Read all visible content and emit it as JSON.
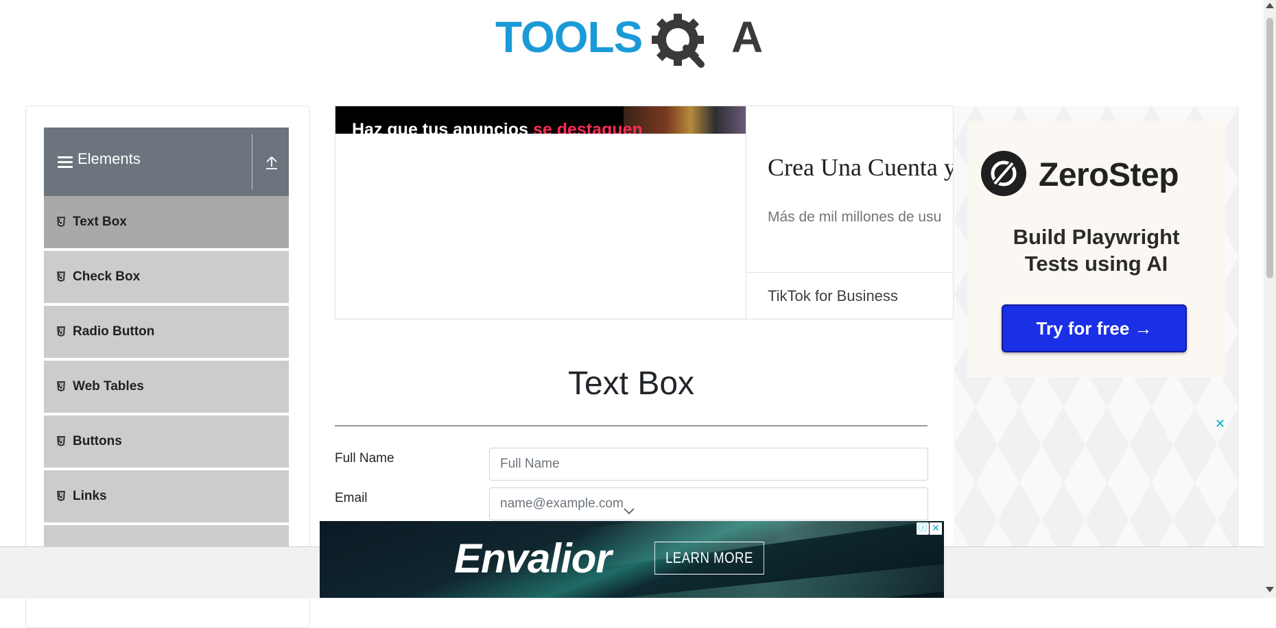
{
  "header": {
    "logo_text": "TOOLSQA"
  },
  "sidebar": {
    "group_title": "Elements",
    "items": [
      {
        "label": "Text Box",
        "active": true
      },
      {
        "label": "Check Box"
      },
      {
        "label": "Radio Button"
      },
      {
        "label": "Web Tables"
      },
      {
        "label": "Buttons"
      },
      {
        "label": "Links"
      }
    ]
  },
  "top_ad": {
    "banner_text": "Haz que tus anuncios",
    "banner_highlight": "se destaquen",
    "headline": "Crea Una Cuenta y",
    "subtext": "Más de mil millones de usu",
    "brand": "TikTok for Business"
  },
  "main": {
    "title": "Text Box",
    "fields": [
      {
        "label": "Full Name",
        "placeholder": "Full Name"
      },
      {
        "label": "Email",
        "placeholder": "name@example.com"
      }
    ]
  },
  "right_ad": {
    "brand": "ZeroStep",
    "tagline_line1": "Build Playwright",
    "tagline_line2": "Tests using AI",
    "cta": "Try for free →",
    "close": "✕"
  },
  "bottom_ad": {
    "brand": "Envalior",
    "cta": "LEARN MORE",
    "info": "ⓘ",
    "close": "✕"
  },
  "colors": {
    "accent_blue": "#1a9bd7",
    "sidebar_header": "#6c757d",
    "sidebar_item": "#cccccc",
    "sidebar_item_active": "#a9a9a9",
    "cta_blue": "#1a2fe6",
    "tiktok_pink": "#fe2c55"
  }
}
